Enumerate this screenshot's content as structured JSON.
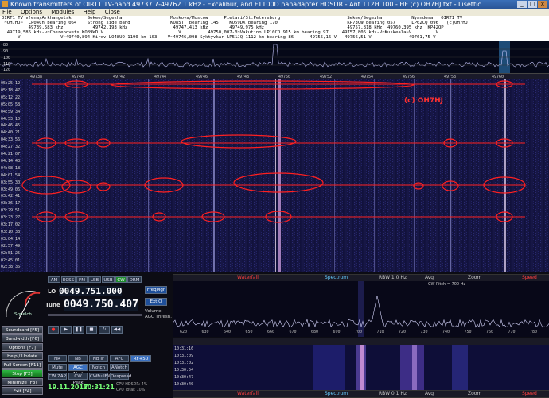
{
  "window": {
    "title": "Known transmitters of OIRT1 TV-band 49737.7-49762.1 kHz - Excalibur, and FT100D panadapter HDSDR - Ant 112H 100 - HF (c) OH7HJ.txt - Lisettic",
    "min_label": "_",
    "max_label": "□",
    "close_label": "x"
  },
  "menu": [
    "File",
    "Options",
    "Modules",
    "Help",
    "Close"
  ],
  "annotations": [
    "OIRT1 TV v!ena/Arkhangelsk      Sekee/Segezha                  Moskova/Moscow      Pietari/St.Petersburg                         Sekee/Segezha           Nyandoma   OIRT1 TV",
    " ~OH7HJ~  LP04Ch bearing 064    Strong side band               KO85TT bearing 145    KO59DX bearing 170                          KP73CW bearing 057      LP02CQ 096   (c)OH7HJ",
    "          49739,583 kHz           49742,193 kHz                 49747,413 kHz        49749,975 kHz                               49757,818 kHz  49760,395 kHz  KP42QP",
    "  49719,586 kHz-v~Cherepovets KO89WD V                            V          49750,007-V~Vakutino LP10CO 915 km bearing 97     49757,806 kHz-V~Kuskeala~V         V",
    "      V               V~49740,894 Kirov LO48UO 1190 km 103    V~49746,098 Syktyvkar LP51JQ 1112 km bearing 86      49755,16-V   49756,51-V              49761,75-V"
  ],
  "spectrum_scale": [
    "-80",
    "-90",
    "-100",
    "-110",
    "-120"
  ],
  "freq_ticks": [
    "49738",
    "49740",
    "49742",
    "49744",
    "49746",
    "49748",
    "49750",
    "49752",
    "49754",
    "49756",
    "49758",
    "49760"
  ],
  "times": [
    "05:25:12",
    "05:18:47",
    "05:12:22",
    "05:05:58",
    "04:59:34",
    "04:53:10",
    "04:46:45",
    "04:40:21",
    "04:33:56",
    "04:27:32",
    "04:21:07",
    "04:14:43",
    "04:08:18",
    "04:01:54",
    "03:55:30",
    "03:49:06",
    "03:42:41",
    "03:36:17",
    "03:29:51",
    "03:23:27",
    "03:17:02",
    "03:10:38",
    "03:04:14",
    "02:57:49",
    "02:51:25",
    "02:45:01",
    "02:38:36"
  ],
  "copyright": "(c) OH7HJ",
  "controls": {
    "lo_label": "LO",
    "lo_value": "0049.751.000",
    "tune_label": "Tune",
    "tune_value": "0049.750.407",
    "mode_buttons": [
      "AM",
      "ECSS",
      "FM",
      "LSB",
      "USB",
      "CW",
      "DRM"
    ],
    "freqmgr": "FreqMgr",
    "extio": "ExtIO",
    "volume": "Volume",
    "agc_thresh": "AGC Thresh.",
    "squelch": "Squelch",
    "side_buttons": [
      "Soundcard [F5]",
      "Bandwidth [F6]",
      "Options [F7]",
      "Help / Update [F9]",
      "Full Screen [F11]",
      "Stop [F2]",
      "Minimize [F3]",
      "Exit [F4]"
    ],
    "dsp_row1": [
      "NR",
      "NB",
      "NB IF",
      "AFC",
      "RF+50"
    ],
    "dsp_row2": [
      "Mute",
      "AGC Med",
      "Notch",
      "ANotch"
    ],
    "dsp_row3": [
      "CW ZAP",
      "CW Peak",
      "CWFullBW",
      "Despread"
    ],
    "date": "19.11.2017",
    "time": "10:31:21",
    "cpu1": "CPU HDSDR: 4%",
    "cpu2": "CPU Total: 10%"
  },
  "waterfall_bar": {
    "waterfall": "Waterfall",
    "spectrum": "Spectrum",
    "rbw1": "RBW 1.0 Hz",
    "avg": "Avg",
    "zoom": "Zoom",
    "speed": "Speed"
  },
  "audio": {
    "cw_pitch": "CW Pitch = 700 Hz",
    "ticks": [
      "620",
      "630",
      "640",
      "650",
      "660",
      "670",
      "680",
      "690",
      "700",
      "710",
      "720",
      "730",
      "740",
      "750",
      "760",
      "770",
      "780"
    ],
    "times": [
      "10:31:16",
      "10:31:09",
      "10:31:02",
      "10:30:54",
      "10:30:47",
      "10:30:40"
    ],
    "rbw2": "RBW 0.1 Hz"
  },
  "colors": {
    "accent": "#ff2020",
    "wf_bg": "#10103a",
    "green": "#1d8a2d",
    "blue": "#1e4f9a"
  }
}
